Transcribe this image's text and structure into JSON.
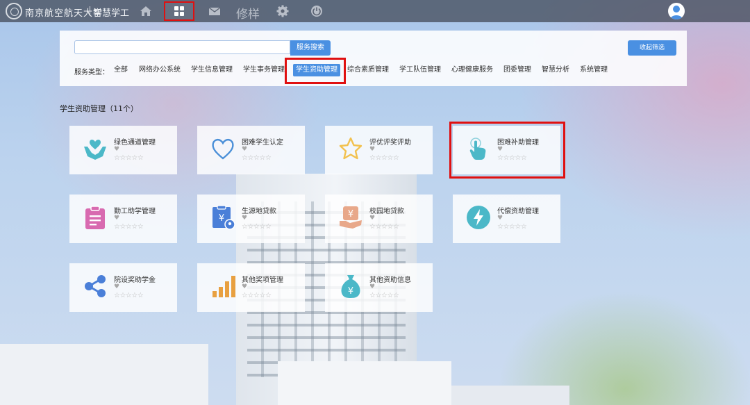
{
  "topbar": {
    "school_name": "南京航空航天大学",
    "app_name": "智慧学工",
    "help_text": "修样",
    "icons": [
      "home-icon",
      "apps-grid-icon",
      "mail-icon",
      "help-icon",
      "gear-icon",
      "power-icon",
      "user-avatar-icon"
    ]
  },
  "search": {
    "value": "",
    "placeholder": "",
    "button_label": "服务搜索"
  },
  "collapse_label": "收起筛选",
  "filters": {
    "label": "服务类型：",
    "categories": [
      "全部",
      "网络办公系统",
      "学生信息管理",
      "学生事务管理",
      "学生资助管理",
      "综合素质管理",
      "学工队伍管理",
      "心理健康服务",
      "团委管理",
      "智慧分析",
      "系统管理"
    ],
    "active": "学生资助管理"
  },
  "section": {
    "title": "学生资助管理（11个）"
  },
  "cards": [
    {
      "title": "绿色通道管理",
      "icon": "hands-heart-icon",
      "heart": "♥",
      "stars": "☆☆☆☆☆"
    },
    {
      "title": "困难学生认定",
      "icon": "heart-outline-icon",
      "heart": "♥",
      "stars": "☆☆☆☆☆"
    },
    {
      "title": "评优评奖评助",
      "icon": "star-icon",
      "heart": "♥",
      "stars": "☆☆☆☆☆"
    },
    {
      "title": "困难补助管理",
      "icon": "hand-pointer-icon",
      "heart": "♥",
      "stars": "☆☆☆☆☆"
    },
    {
      "title": "勤工助学管理",
      "icon": "clipboard-icon",
      "heart": "♥",
      "stars": "☆☆☆☆☆"
    },
    {
      "title": "生源地贷款",
      "icon": "yuan-document-icon",
      "heart": "♥",
      "stars": "☆☆☆☆☆"
    },
    {
      "title": "校园地贷款",
      "icon": "yuan-hand-icon",
      "heart": "♥",
      "stars": "☆☆☆☆☆"
    },
    {
      "title": "代偿资助管理",
      "icon": "lightning-icon",
      "heart": "♥",
      "stars": "☆☆☆☆☆"
    },
    {
      "title": "院设奖助学金",
      "icon": "share-icon",
      "heart": "♥",
      "stars": "☆☆☆☆☆"
    },
    {
      "title": "其他奖项管理",
      "icon": "bar-chart-icon",
      "heart": "♥",
      "stars": "☆☆☆☆☆"
    },
    {
      "title": "其他资助信息",
      "icon": "money-bag-icon",
      "heart": "♥",
      "stars": "☆☆☆☆☆"
    }
  ],
  "colors": {
    "accent": "#4a90e2",
    "highlight": "#e01010",
    "icon_teal": "#4bb8c8",
    "icon_blue": "#4a7fd8",
    "icon_yellow": "#f2c14e",
    "icon_pink": "#d86ab0",
    "icon_orange": "#e8a040"
  }
}
